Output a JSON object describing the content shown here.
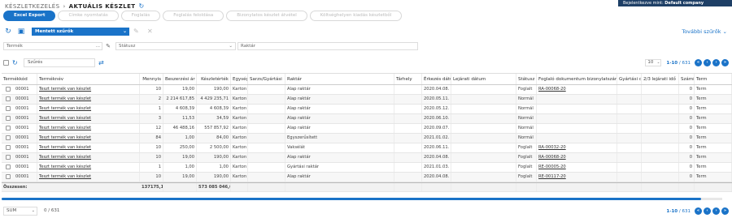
{
  "topbar": {
    "prefix": "Bejelentkezve mint: ",
    "company": "Default company"
  },
  "breadcrumb": {
    "parent": "KÉSZLETKEZELÉS",
    "separator": "›",
    "current": "AKTUÁLIS KÉSZLET"
  },
  "actions": [
    {
      "label": "Excel Export",
      "primary": true
    },
    {
      "label": "Címke nyomtatás",
      "primary": false
    },
    {
      "label": "Foglalás",
      "primary": false
    },
    {
      "label": "Foglalás feloldása",
      "primary": false
    },
    {
      "label": "Bizonylatos készlet átvétel",
      "primary": false
    },
    {
      "label": "Költséghelyen kiadás készletből",
      "primary": false
    }
  ],
  "saved_filter": {
    "value": "Mentett szűrők"
  },
  "more_filters": "További szűrők",
  "filters": {
    "product_placeholder": "Termék",
    "status_placeholder": "Státusz",
    "warehouse_placeholder": "Raktár"
  },
  "search": {
    "placeholder": "Szűrés"
  },
  "pagination": {
    "page_size": "10",
    "range": "1-10",
    "separator": " / ",
    "total": "631"
  },
  "table": {
    "columns": [
      "Termékkód",
      "Terméknév",
      "Mennyis",
      "Beszerzési ár",
      "Készletérték",
      "Egység",
      "Sarzs/Gyártási",
      "Raktár",
      "Tárhely",
      "Érkezés dátuma",
      "Lejárati dátum",
      "Státusz",
      "Foglaló dokumentum bizonylatszáma",
      "Gyártási d",
      "2/3 lejárati idő",
      "Számít",
      "Term"
    ],
    "rows": [
      [
        "00001",
        "Teszt termék van készlet",
        "10",
        "19,00",
        "190,00",
        "Karton",
        "",
        "Alap raktár",
        "",
        "2020.04.08. 10:33",
        "",
        "Foglalt",
        "RA-00068-20",
        "",
        "",
        "0",
        "Term"
      ],
      [
        "00001",
        "Teszt termék van készlet",
        "2",
        "2 214 617,85",
        "4 429 235,71",
        "Karton",
        "",
        "Alap raktár",
        "",
        "2020.05.11. 16:02",
        "",
        "Normál",
        "",
        "",
        "",
        "0",
        "Term"
      ],
      [
        "00001",
        "Teszt termék van készlet",
        "1",
        "4 608,39",
        "4 608,39",
        "Karton",
        "",
        "Alap raktár",
        "",
        "2020.05.12. 16:23",
        "",
        "Normál",
        "",
        "",
        "",
        "0",
        "Term"
      ],
      [
        "00001",
        "Teszt termék van készlet",
        "3",
        "11,53",
        "34,59",
        "Karton",
        "",
        "Alap raktár",
        "",
        "2020.06.10. 10:43",
        "",
        "Normál",
        "",
        "",
        "",
        "0",
        "Term"
      ],
      [
        "00001",
        "Teszt termék van készlet",
        "12",
        "46 488,16",
        "557 857,92",
        "Karton",
        "",
        "Alap raktár",
        "",
        "2020.09.07. 13:35",
        "",
        "Normál",
        "",
        "",
        "",
        "0",
        "Term"
      ],
      [
        "00001",
        "Teszt termék van készlet",
        "84",
        "1,00",
        "84,00",
        "Karton",
        "",
        "Egyszerűsített",
        "",
        "2021.01.02. 15:48",
        "",
        "Normál",
        "",
        "",
        "",
        "0",
        "Term"
      ],
      [
        "00001",
        "Teszt termék van készlet",
        "10",
        "250,00",
        "2 500,00",
        "Karton",
        "",
        "Vaksélát",
        "",
        "2020.06.11. 13:35",
        "",
        "Foglalt",
        "RA-00032-20",
        "",
        "",
        "0",
        "Term"
      ],
      [
        "00001",
        "Teszt termék van készlet",
        "10",
        "19,00",
        "190,00",
        "Karton",
        "",
        "Alap raktár",
        "",
        "2020.04.08. 10:33",
        "",
        "Foglalt",
        "RA-00068-20",
        "",
        "",
        "0",
        "Term"
      ],
      [
        "00001",
        "Teszt termék van készlet",
        "1",
        "1,00",
        "1,00",
        "Karton",
        "",
        "Gyártási raktár",
        "",
        "2021.01.03. 14:13",
        "",
        "Foglalt",
        "RE-00005-20",
        "",
        "",
        "0",
        "Term"
      ],
      [
        "00001",
        "Teszt termék van készlet",
        "10",
        "19,00",
        "190,00",
        "Karton",
        "",
        "Alap raktár",
        "",
        "2020.04.08. 10:33",
        "",
        "Foglalt",
        "RE-00117-20",
        "",
        "",
        "0",
        "Term"
      ]
    ],
    "totals": {
      "label": "Összesen:",
      "quantity": "137175,1",
      "stock_value": "573 085 046,0"
    }
  },
  "footer": {
    "aggregate": "SUM",
    "selected": "0",
    "separator": " / ",
    "total": "631"
  },
  "colors": {
    "accent": "#1a73c8",
    "topbar": "#1e3f66"
  }
}
